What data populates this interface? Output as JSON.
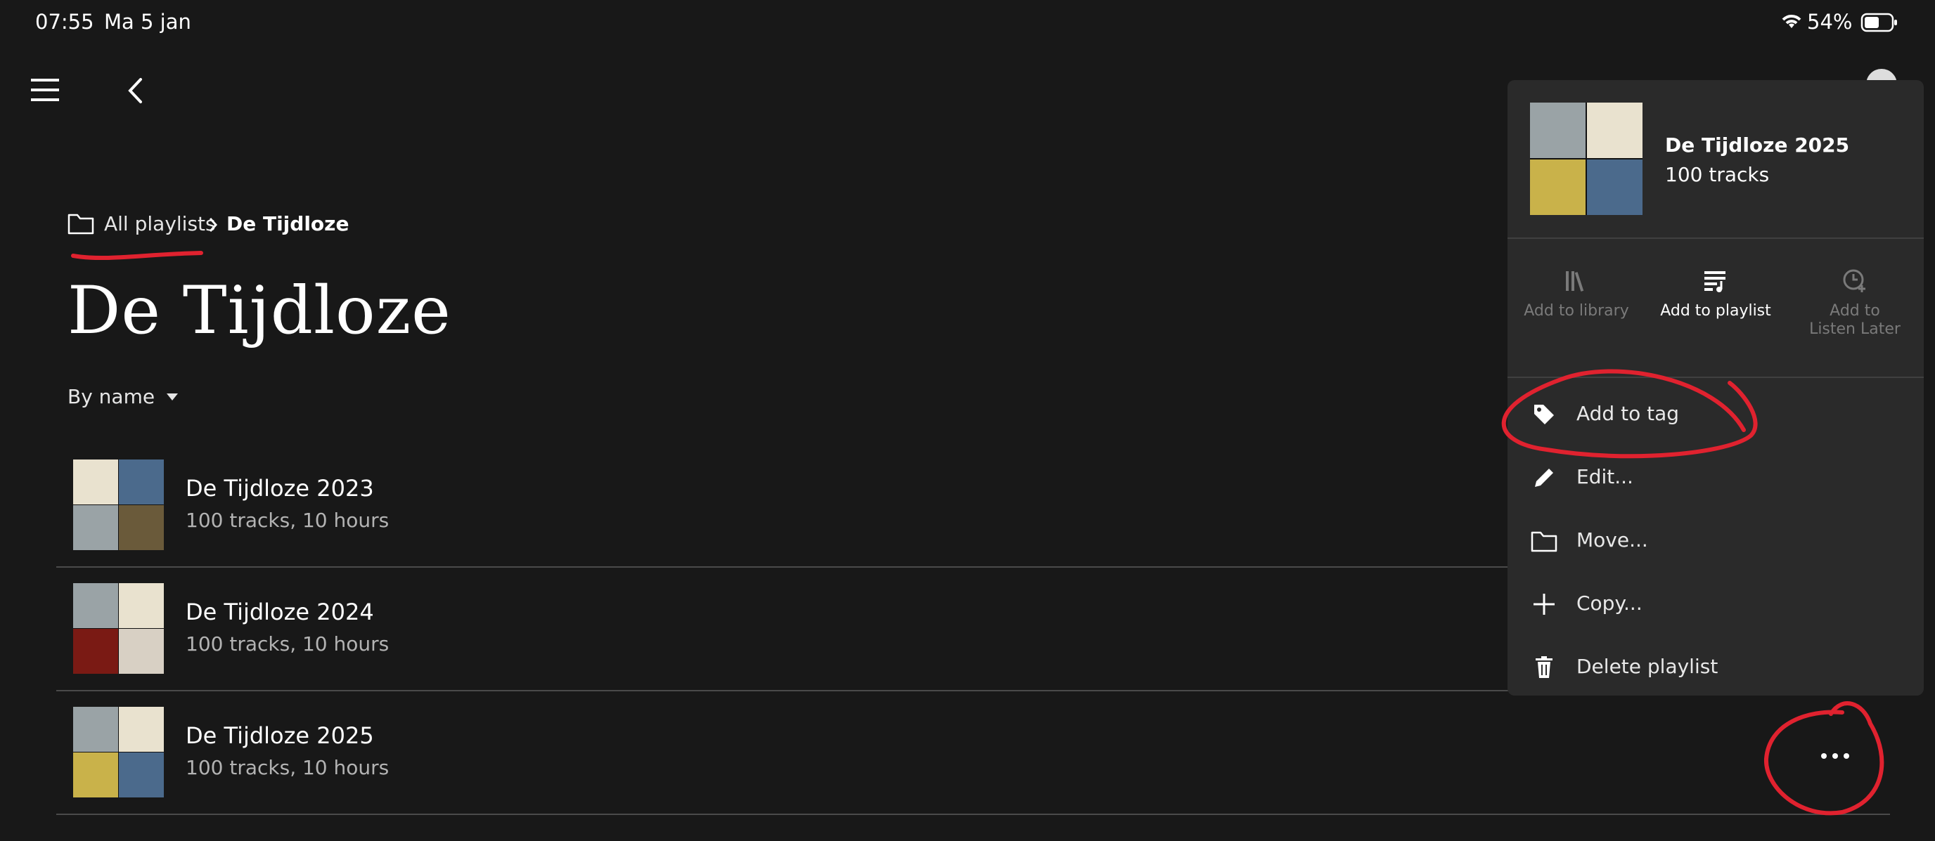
{
  "status_bar": {
    "time": "07:55",
    "date": "Ma 5 jan",
    "battery": "54%"
  },
  "breadcrumb": {
    "parent": "All playlists",
    "current": "De Tijdloze"
  },
  "page": {
    "title": "De Tijdloze",
    "sort_label": "By name"
  },
  "playlists": [
    {
      "title": "De Tijdloze 2023",
      "subtitle": "100 tracks, 10 hours"
    },
    {
      "title": "De Tijdloze 2024",
      "subtitle": "100 tracks, 10 hours"
    },
    {
      "title": "De Tijdloze 2025",
      "subtitle": "100 tracks, 10 hours"
    }
  ],
  "context_menu": {
    "title": "De Tijdloze 2025",
    "subtitle": "100 tracks",
    "actions": [
      {
        "label": "Add to library",
        "enabled": false
      },
      {
        "label": "Add to playlist",
        "enabled": true
      },
      {
        "label": "Add to Listen Later",
        "enabled": false
      }
    ],
    "items": [
      {
        "label": "Add to tag",
        "icon": "tag-icon"
      },
      {
        "label": "Edit...",
        "icon": "pencil-icon"
      },
      {
        "label": "Move...",
        "icon": "folder-icon"
      },
      {
        "label": "Copy...",
        "icon": "plus-icon"
      },
      {
        "label": "Delete playlist",
        "icon": "trash-icon"
      }
    ]
  },
  "colors": {
    "background": "#181818",
    "menu_background": "#2a2a2a",
    "annotation": "#e0222f",
    "disabled_text": "#7a7a7a"
  }
}
